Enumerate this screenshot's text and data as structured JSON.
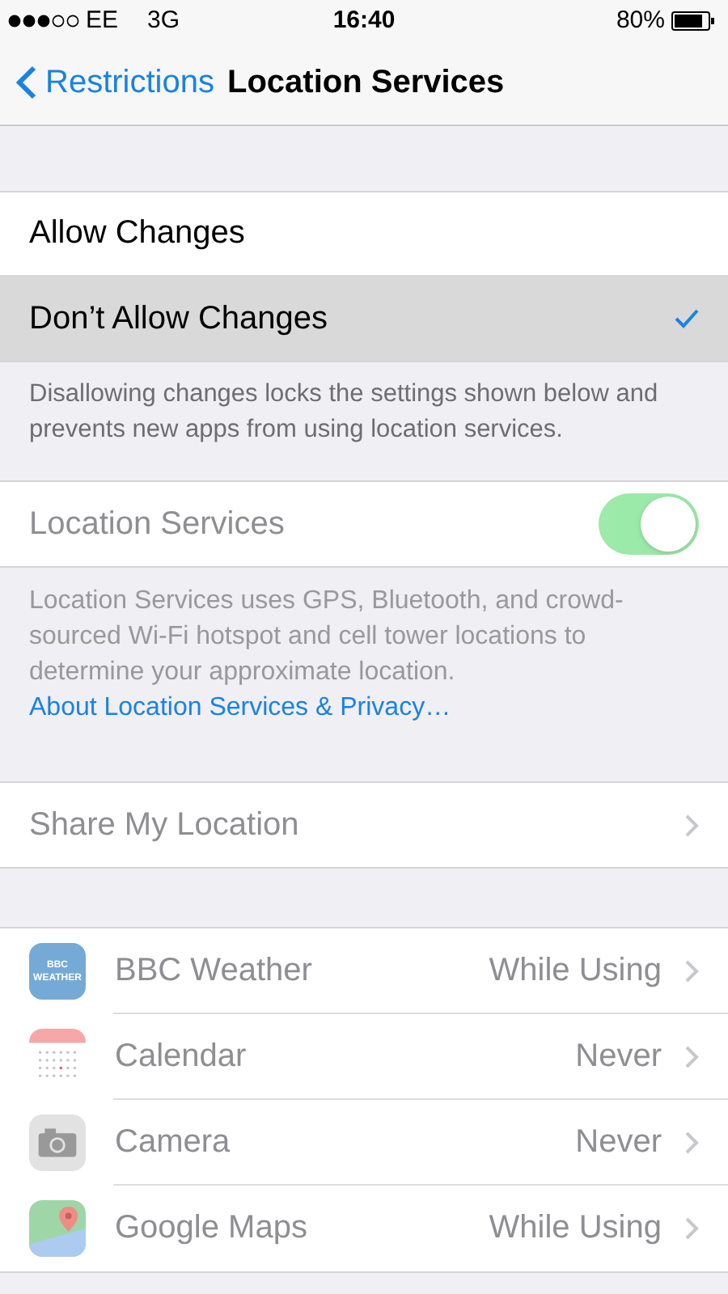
{
  "status_bar": {
    "carrier": "EE",
    "network": "3G",
    "time": "16:40",
    "battery": "80%"
  },
  "nav": {
    "back": "Restrictions",
    "title": "Location Services"
  },
  "options": [
    {
      "label": "Allow Changes",
      "selected": false
    },
    {
      "label": "Don’t Allow Changes",
      "selected": true
    }
  ],
  "options_footer": "Disallowing changes locks the settings shown below and prevents new apps from using location services.",
  "location_services": {
    "label": "Location Services",
    "on": true,
    "disabled": true
  },
  "location_footer": {
    "text": "Location Services uses GPS, Bluetooth, and crowd-sourced Wi-Fi hotspot and cell tower locations to determine your approximate location.",
    "link": "About Location Services & Privacy…"
  },
  "share": {
    "label": "Share My Location",
    "disabled": true
  },
  "apps": [
    {
      "name": "BBC Weather",
      "value": "While Using",
      "disabled": true,
      "icon_text": "BBC WEATHER"
    },
    {
      "name": "Calendar",
      "value": "Never",
      "disabled": true
    },
    {
      "name": "Camera",
      "value": "Never",
      "disabled": true
    },
    {
      "name": "Google Maps",
      "value": "While Using",
      "disabled": true
    }
  ]
}
